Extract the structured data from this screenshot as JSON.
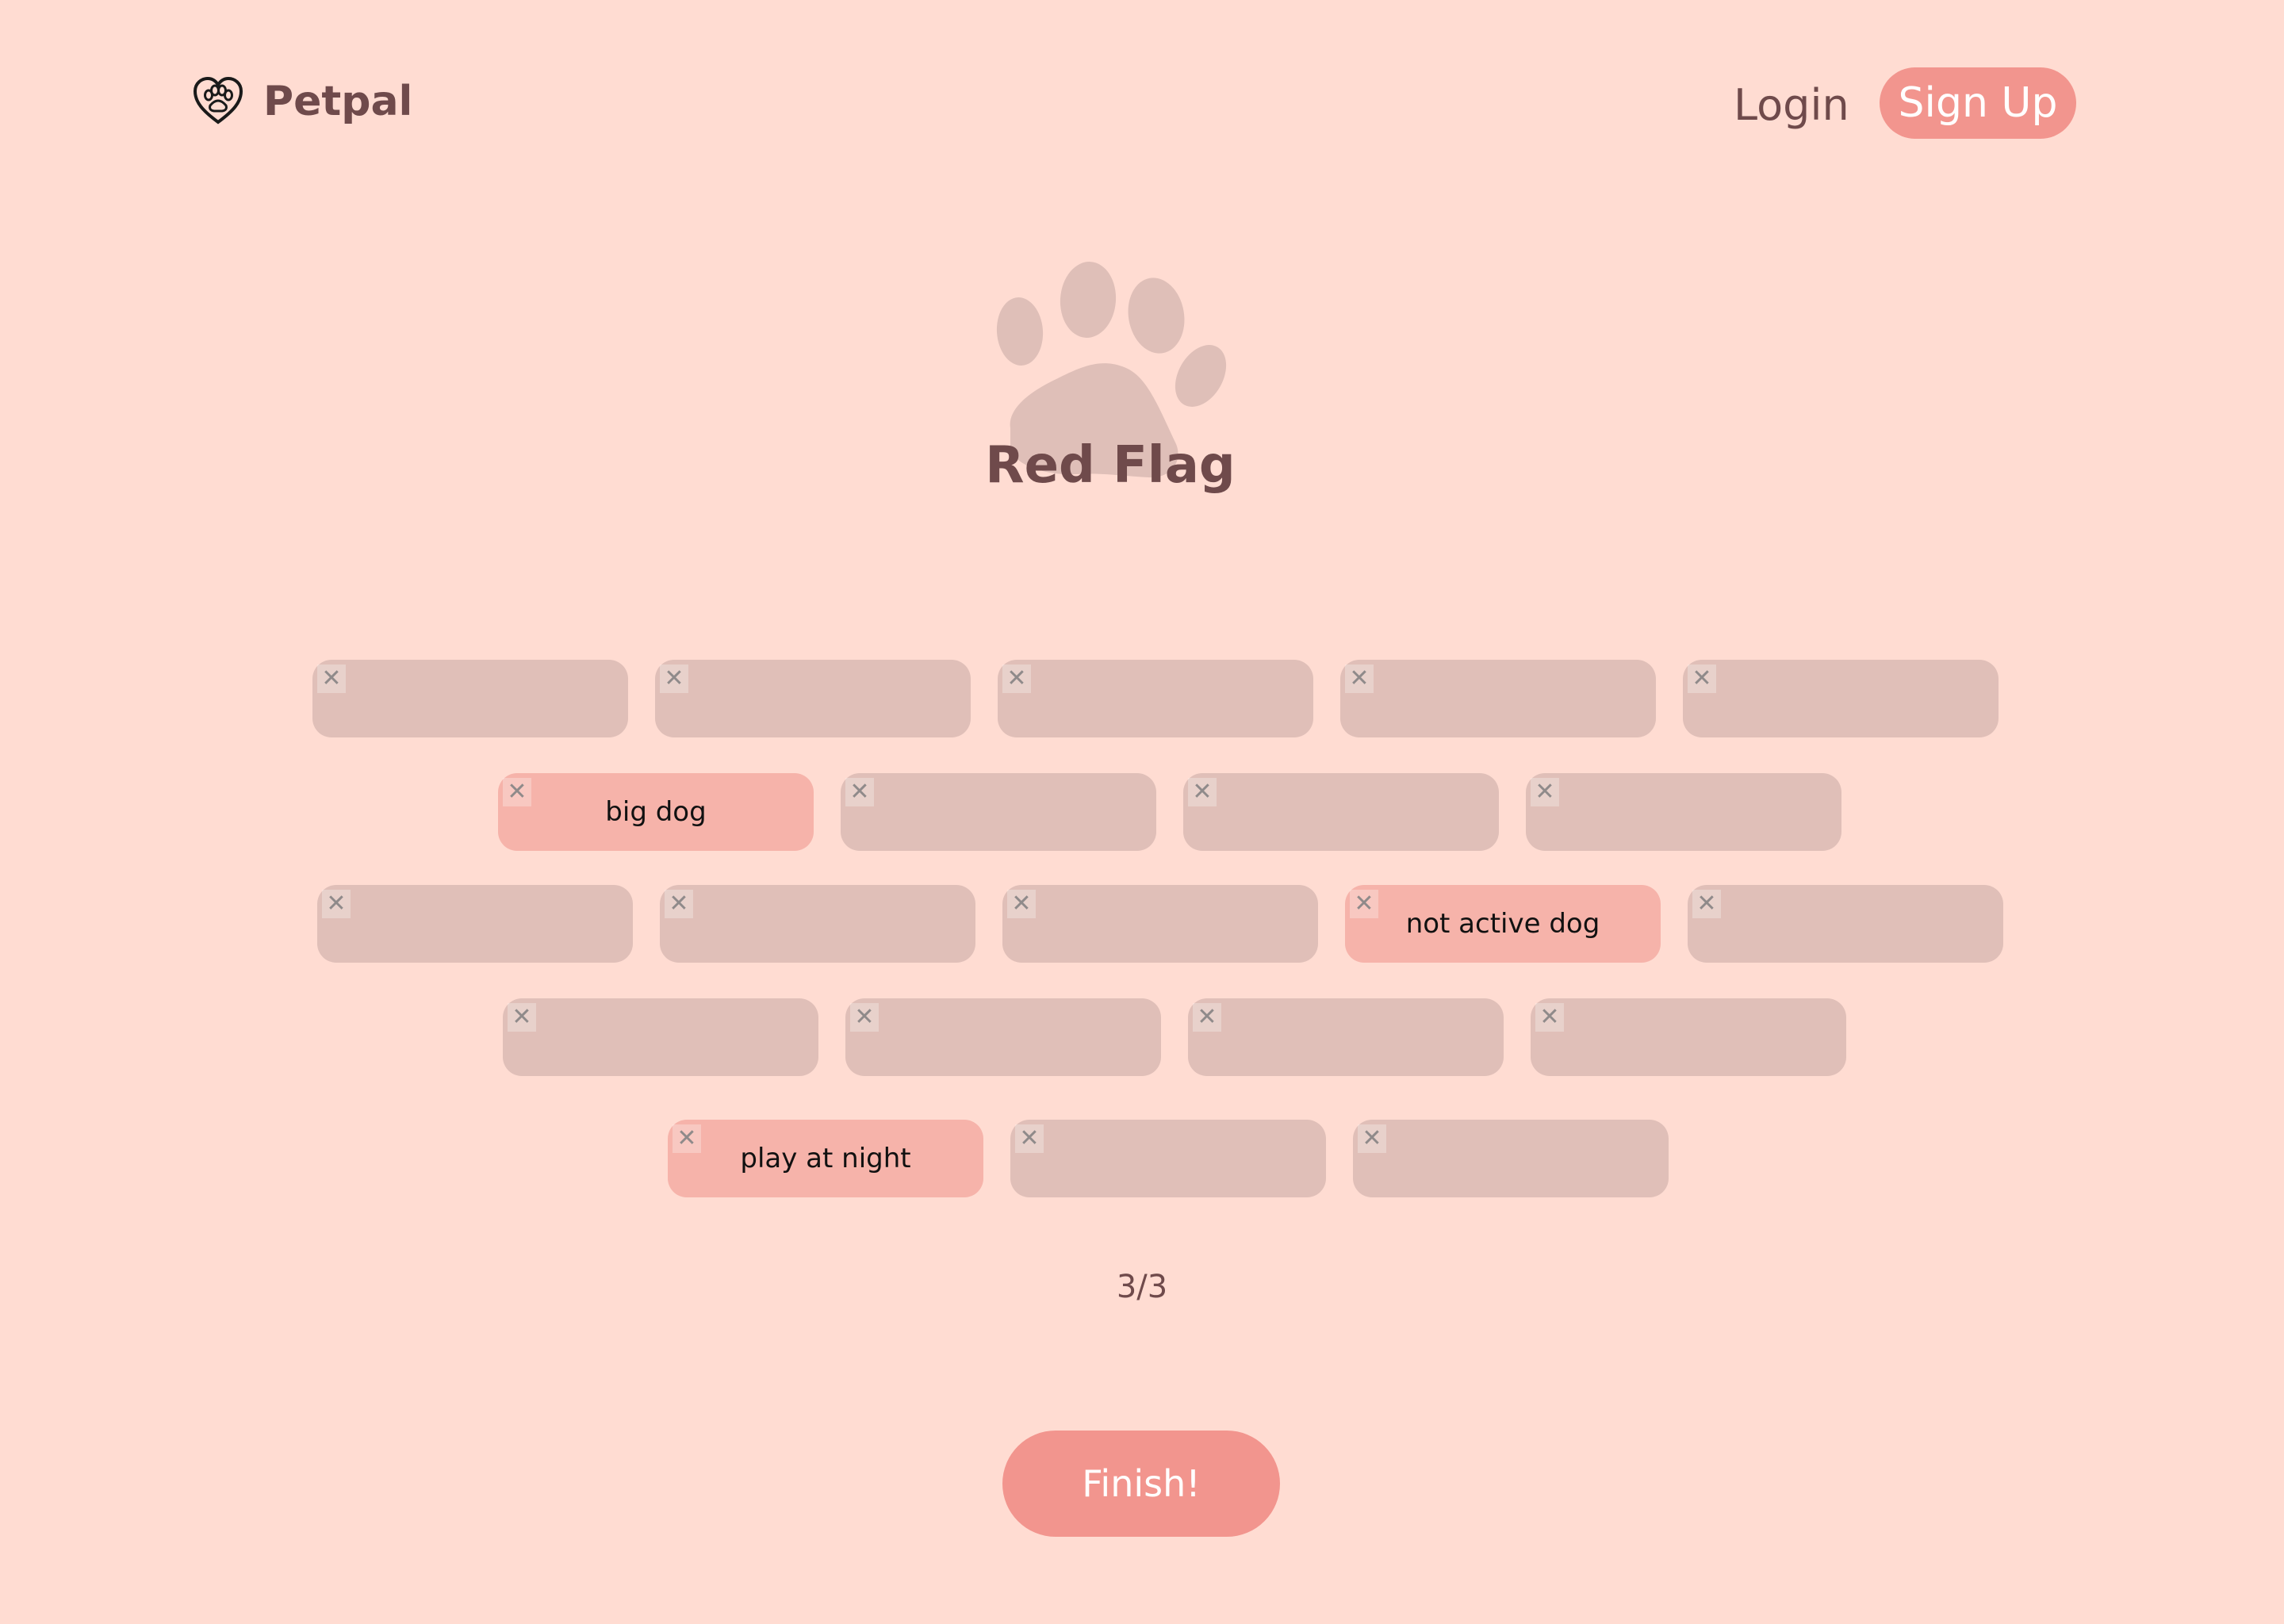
{
  "brand": {
    "name": "Petpal",
    "icon": "heart-paw-icon"
  },
  "nav": {
    "login_label": "Login",
    "signup_label": "Sign Up"
  },
  "hero": {
    "title": "Red Flag",
    "icon": "paw-icon"
  },
  "tags": {
    "rows": [
      [
        {
          "label": "",
          "selected": false
        },
        {
          "label": "",
          "selected": false
        },
        {
          "label": "",
          "selected": false
        },
        {
          "label": "",
          "selected": false
        },
        {
          "label": "",
          "selected": false
        }
      ],
      [
        {
          "label": "big dog",
          "selected": true
        },
        {
          "label": "",
          "selected": false
        },
        {
          "label": "",
          "selected": false
        },
        {
          "label": "",
          "selected": false
        }
      ],
      [
        {
          "label": "",
          "selected": false
        },
        {
          "label": "",
          "selected": false
        },
        {
          "label": "",
          "selected": false
        },
        {
          "label": "not active dog",
          "selected": true
        },
        {
          "label": "",
          "selected": false
        }
      ],
      [
        {
          "label": "",
          "selected": false
        },
        {
          "label": "",
          "selected": false
        },
        {
          "label": "",
          "selected": false
        },
        {
          "label": "",
          "selected": false
        }
      ],
      [
        {
          "label": "play at night",
          "selected": true
        },
        {
          "label": "",
          "selected": false
        },
        {
          "label": "",
          "selected": false
        }
      ]
    ]
  },
  "progress": {
    "counter_text": "3/3"
  },
  "actions": {
    "finish_label": "Finish!"
  },
  "colors": {
    "background": "#ffdcd2",
    "accent": "#f2958e",
    "tag_default": "#e0bfb8",
    "tag_selected": "#f6b3aa",
    "text_dark": "#6f4a4b"
  }
}
